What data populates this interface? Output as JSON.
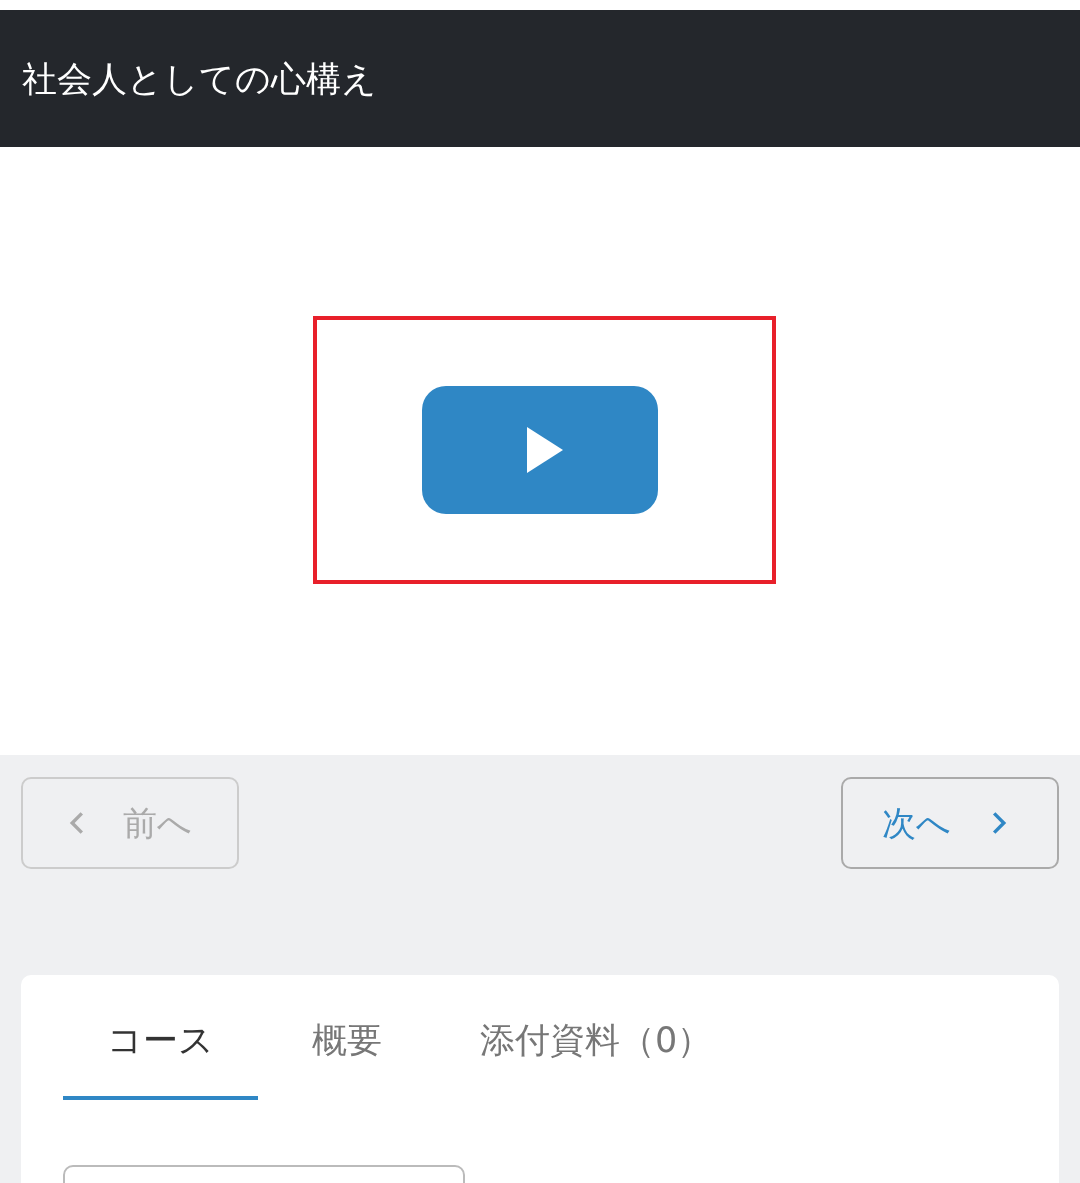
{
  "header": {
    "title": "社会人としての心構え"
  },
  "video": {
    "highlighted": true
  },
  "navigation": [
    {
      "kind": "previous",
      "label": "前へ",
      "disabled": true
    },
    {
      "kind": "next",
      "label": "次へ",
      "disabled": false
    }
  ],
  "tabs": [
    {
      "label": "コース",
      "selected": true
    },
    {
      "label": "概要",
      "selected": false
    },
    {
      "label": "添付資料（0）",
      "selected": false
    }
  ]
}
